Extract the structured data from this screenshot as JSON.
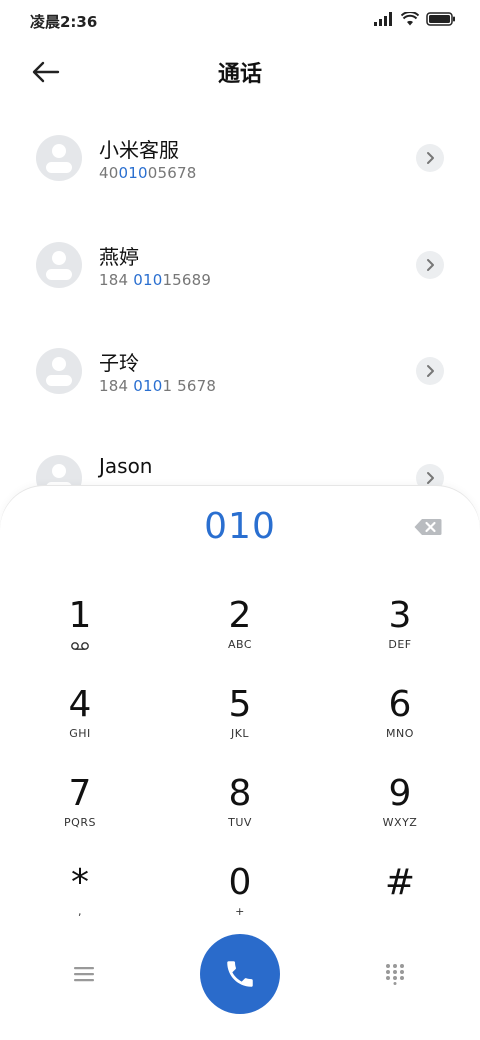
{
  "status_bar": {
    "time": "凌晨2:36"
  },
  "header": {
    "title": "通话"
  },
  "contacts": [
    {
      "name": "小米客服",
      "number_pre": "40",
      "number_hl": "010",
      "number_post": "05678"
    },
    {
      "name": "燕婷",
      "number_pre": "184 ",
      "number_hl": "010",
      "number_post": "15689"
    },
    {
      "name": "子玲",
      "number_pre": "184 ",
      "number_hl": "010",
      "number_post": "1 5678"
    },
    {
      "name": "Jason",
      "number_pre": "",
      "number_hl": "",
      "number_post": ""
    }
  ],
  "dialpad": {
    "input": "010",
    "keys": [
      {
        "digit": "1",
        "letters": ""
      },
      {
        "digit": "2",
        "letters": "ABC"
      },
      {
        "digit": "3",
        "letters": "DEF"
      },
      {
        "digit": "4",
        "letters": "GHI"
      },
      {
        "digit": "5",
        "letters": "JKL"
      },
      {
        "digit": "6",
        "letters": "MNO"
      },
      {
        "digit": "7",
        "letters": "PQRS"
      },
      {
        "digit": "8",
        "letters": "TUV"
      },
      {
        "digit": "9",
        "letters": "WXYZ"
      },
      {
        "digit": "*",
        "letters": ","
      },
      {
        "digit": "0",
        "letters": "+"
      },
      {
        "digit": "#",
        "letters": ""
      }
    ]
  },
  "icons": {
    "back": "arrow-left-icon",
    "detail": "chevron-right-icon",
    "backspace": "backspace-icon",
    "voicemail": "voicemail-icon",
    "menu": "menu-icon",
    "call": "phone-icon",
    "keypad": "dialpad-icon"
  },
  "colors": {
    "accent": "#2a6fd0",
    "call_button": "#2a6bcb"
  }
}
